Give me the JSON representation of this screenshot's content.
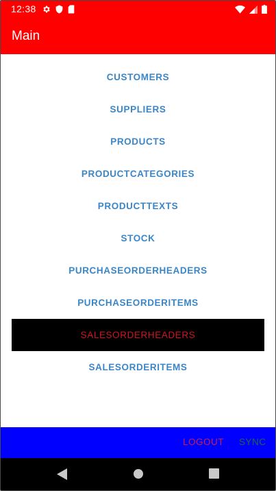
{
  "status_bar": {
    "time": "12:38",
    "icons_left": [
      "settings-gear-icon",
      "shield-icon",
      "sd-card-icon"
    ],
    "icons_right": [
      "wifi-icon",
      "cell-signal-icon",
      "battery-icon"
    ]
  },
  "app_bar": {
    "title": "Main",
    "color": "#ff0000"
  },
  "menu": {
    "items": [
      {
        "label": "CUSTOMERS"
      },
      {
        "label": "SUPPLIERS"
      },
      {
        "label": "PRODUCTS"
      },
      {
        "label": "PRODUCTCATEGORIES"
      },
      {
        "label": "PRODUCTTEXTS"
      },
      {
        "label": "STOCK"
      },
      {
        "label": "PURCHASEORDERHEADERS"
      },
      {
        "label": "PURCHASEORDERITEMS"
      },
      {
        "label": "SALESORDERHEADERS",
        "selected": true
      },
      {
        "label": "SALESORDERITEMS"
      }
    ],
    "item_color": "#3a86c8",
    "selected_bg": "#000000",
    "selected_color": "#d0141e"
  },
  "bottom_bar": {
    "color": "#0000ff",
    "logout_label": "LOGOUT",
    "sync_label": "SYNC"
  },
  "nav_bar": {
    "buttons": [
      "back-icon",
      "home-icon",
      "recents-icon"
    ]
  }
}
